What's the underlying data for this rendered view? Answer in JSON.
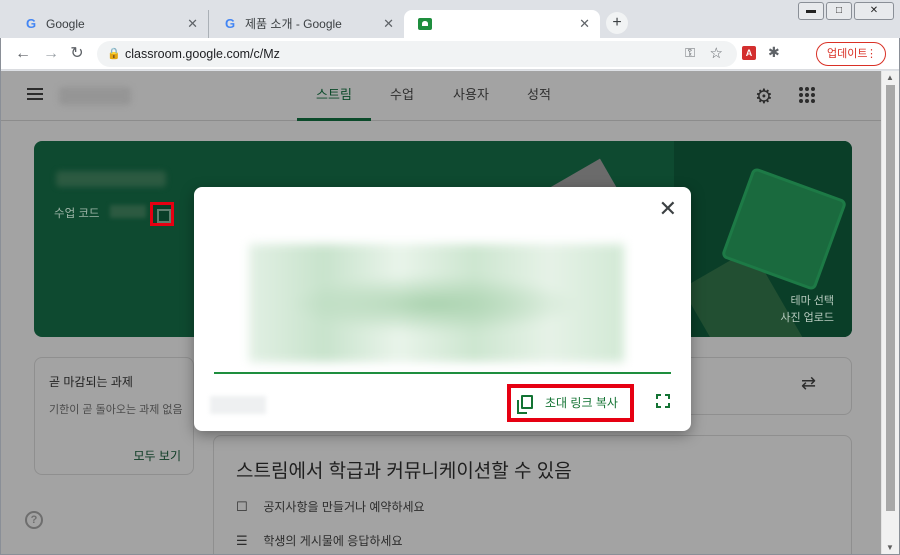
{
  "browser": {
    "tabs": [
      {
        "title": "Google",
        "icon": "google-icon"
      },
      {
        "title": "제품 소개 - Google",
        "icon": "google-icon"
      },
      {
        "title": "",
        "icon": "classroom-icon"
      }
    ],
    "tab_close": "✕",
    "new_tab": "+",
    "window_controls": {
      "minimize": "▬",
      "maximize": "□",
      "close": "✕"
    },
    "nav": {
      "back": "←",
      "forward": "→",
      "reload": "↻"
    },
    "url": "classroom.google.com/c/Mz",
    "lock": "🔒",
    "key_icon": "⚿",
    "star": "☆",
    "pdf_ext": "A",
    "puzzle": "✱",
    "update_label": "업데이트",
    "update_dots": "⋮"
  },
  "classroom": {
    "hamburger": "",
    "tabs": [
      "스트림",
      "수업",
      "사용자",
      "성적"
    ],
    "active_tab": "스트림",
    "gear": "⚙",
    "banner": {
      "code_label": "수업 코드",
      "theme_select": "테마 선택",
      "upload_photo": "사진 업로드"
    },
    "due": {
      "title": "곧 마감되는 과제",
      "desc": "기한이 곧 돌아오는 과제 없음",
      "view_all": "모두 보기"
    },
    "swap": "⇄",
    "stream": {
      "heading": "스트림에서 학급과 커뮤니케이션할 수 있음",
      "items": [
        {
          "icon": "☐",
          "text": "공지사항을 만들거나 예약하세요"
        },
        {
          "icon": "☰",
          "text": "학생의 게시물에 응답하세요"
        }
      ]
    },
    "help": "?"
  },
  "dialog": {
    "close": "✕",
    "invite_link_label": "초대 링크 복사"
  },
  "colors": {
    "accent_green": "#137333",
    "banner_green": "#0e4a30",
    "highlight_red": "#e60012",
    "update_red": "#d93025"
  }
}
